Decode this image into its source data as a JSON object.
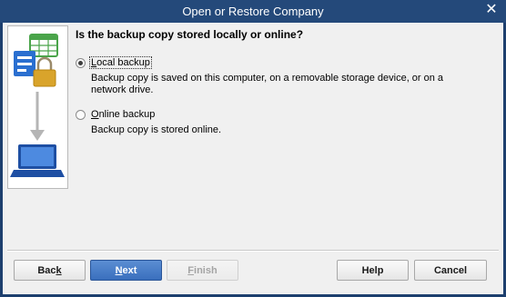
{
  "window": {
    "title": "Open or Restore Company"
  },
  "question": "Is the backup copy stored locally or online?",
  "options": [
    {
      "label_pre": "",
      "label_mnemonic": "L",
      "label_post": "ocal backup",
      "description_lines": [
        "Backup copy is saved on this computer, on a removable storage device, or on a",
        "network drive."
      ],
      "selected": true
    },
    {
      "label_pre": "",
      "label_mnemonic": "O",
      "label_post": "nline backup",
      "description_lines": [
        "Backup copy is stored online."
      ],
      "selected": false
    }
  ],
  "buttons": {
    "back": {
      "pre": "Bac",
      "mnemonic": "k",
      "post": ""
    },
    "next": {
      "pre": "",
      "mnemonic": "N",
      "post": "ext"
    },
    "finish": {
      "pre": "",
      "mnemonic": "F",
      "post": "inish"
    },
    "help": {
      "pre": "",
      "mnemonic": "",
      "post": "Help"
    },
    "cancel": {
      "pre": "",
      "mnemonic": "",
      "post": "Cancel"
    }
  },
  "colors": {
    "titlebar": "#24497a",
    "primary_button": "#3a6fbd",
    "illustration_blue": "#2a6fd0",
    "illustration_green": "#4aa44a",
    "illustration_gold": "#d9a42b"
  }
}
